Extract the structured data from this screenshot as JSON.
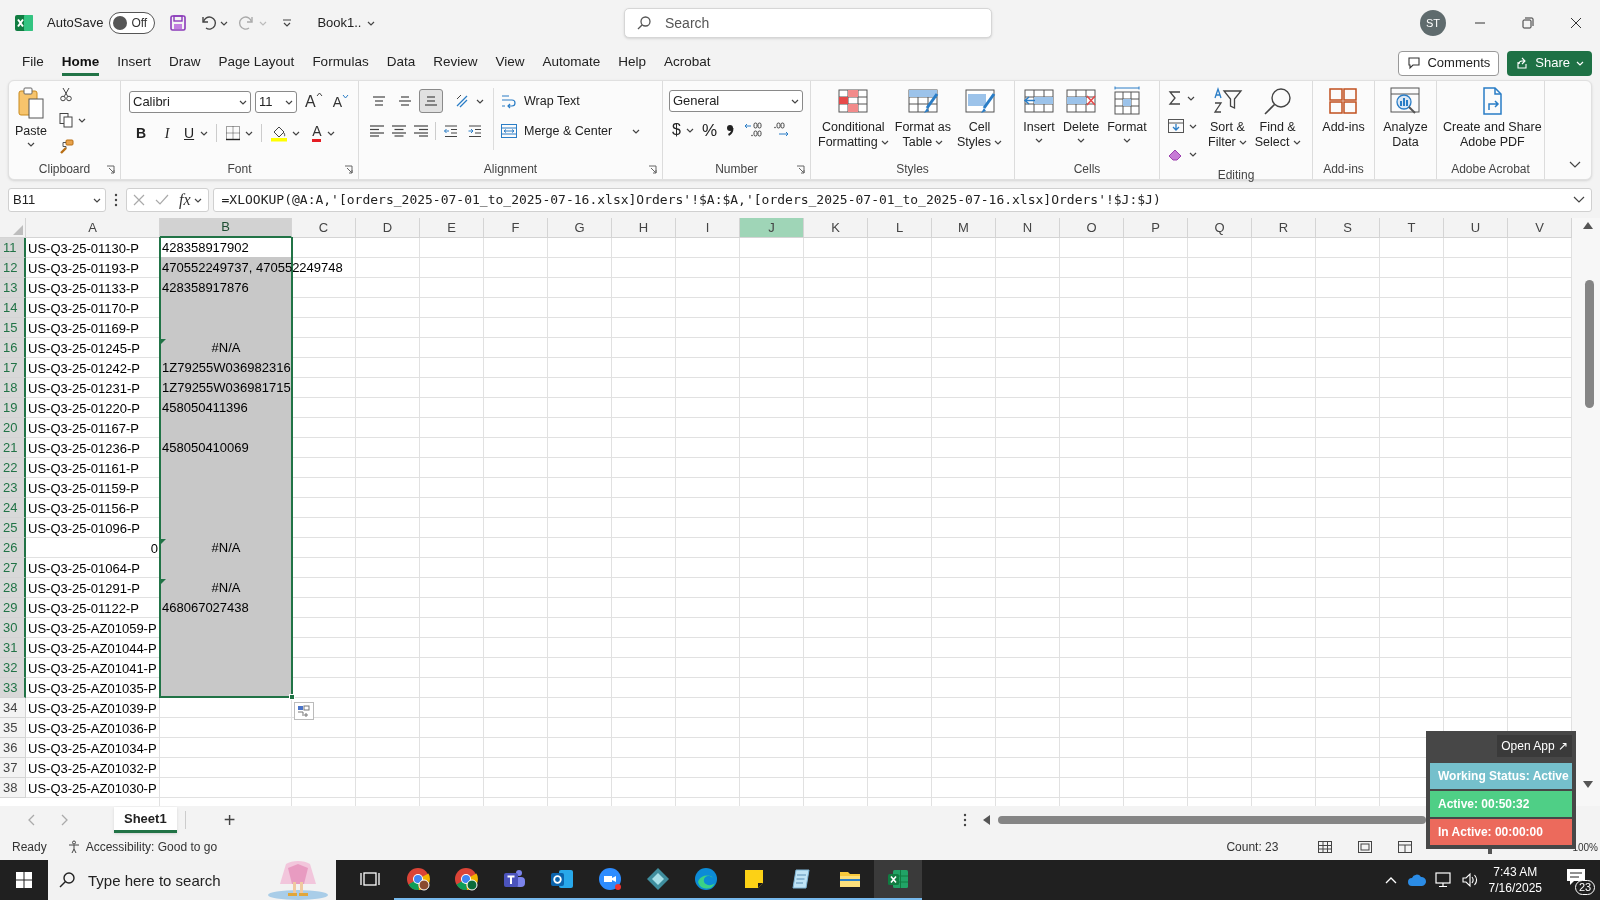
{
  "title_bar": {
    "autosave_label": "AutoSave",
    "autosave_on": false,
    "autosave_state": "Off",
    "document_title": "Book1..",
    "search_placeholder": "Search",
    "avatar": "ST"
  },
  "menu_tabs": [
    {
      "label": "File",
      "selected": false
    },
    {
      "label": "Home",
      "selected": true
    },
    {
      "label": "Insert",
      "selected": false
    },
    {
      "label": "Draw",
      "selected": false
    },
    {
      "label": "Page Layout",
      "selected": false
    },
    {
      "label": "Formulas",
      "selected": false
    },
    {
      "label": "Data",
      "selected": false
    },
    {
      "label": "Review",
      "selected": false
    },
    {
      "label": "View",
      "selected": false
    },
    {
      "label": "Automate",
      "selected": false
    },
    {
      "label": "Help",
      "selected": false
    },
    {
      "label": "Acrobat",
      "selected": false
    }
  ],
  "comments_button": "Comments",
  "share_button": "Share",
  "ribbon_groups": [
    {
      "kind": "clipboard",
      "label": "Clipboard",
      "paste": "Paste"
    },
    {
      "kind": "font",
      "label": "Font",
      "font_name": "Calibri",
      "font_size": "11",
      "grow": "A",
      "shrink": "A",
      "bold": "B",
      "italic": "I",
      "underline": "U",
      "font_color": "A"
    },
    {
      "kind": "alignment",
      "label": "Alignment",
      "vertical_align": [
        {
          "selected": false
        },
        {
          "selected": false
        },
        {
          "selected": true
        }
      ],
      "wrap_text": "Wrap Text",
      "merge": "Merge & Center"
    },
    {
      "kind": "number",
      "label": "Number",
      "format": "General",
      "currency": "$",
      "percent": "%"
    },
    {
      "kind": "styles",
      "label": "Styles",
      "buttons": [
        {
          "lines": [
            "Conditional",
            "Formatting"
          ]
        },
        {
          "lines": [
            "Format as",
            "Table"
          ]
        },
        {
          "lines": [
            "Cell",
            "Styles"
          ]
        }
      ]
    },
    {
      "kind": "cells",
      "label": "Cells",
      "buttons": [
        {
          "lines": [
            "Insert"
          ]
        },
        {
          "lines": [
            "Delete"
          ]
        },
        {
          "lines": [
            "Format"
          ]
        }
      ]
    },
    {
      "kind": "editing",
      "label": "Editing",
      "buttons": [
        {
          "lines": [
            "Sort &",
            "Filter"
          ]
        },
        {
          "lines": [
            "Find &",
            "Select"
          ]
        }
      ]
    },
    {
      "kind": "addins",
      "label": "Add-ins",
      "buttons": [
        {
          "lines": [
            "Add-ins"
          ]
        }
      ]
    },
    {
      "kind": "analyze",
      "buttons": [
        {
          "lines": [
            "Analyze",
            "Data"
          ]
        }
      ]
    },
    {
      "kind": "acrobat",
      "label": "Adobe Acrobat",
      "buttons": [
        {
          "lines": [
            "Create and Share",
            "Adobe PDF"
          ]
        }
      ]
    }
  ],
  "formula_bar": {
    "name_box": "B11",
    "function_button": "fx",
    "formula": "=XLOOKUP(@A:A,'[orders_2025-07-01_to_2025-07-16.xlsx]Orders'!$A:$A,'[orders_2025-07-01_to_2025-07-16.xlsx]Orders'!$J:$J)"
  },
  "columns": [
    {
      "label": "A",
      "selected": false,
      "highlighted": false
    },
    {
      "label": "B",
      "selected": true,
      "highlighted": false
    },
    {
      "label": "C",
      "selected": false,
      "highlighted": false
    },
    {
      "label": "D",
      "selected": false,
      "highlighted": false
    },
    {
      "label": "E",
      "selected": false,
      "highlighted": false
    },
    {
      "label": "F",
      "selected": false,
      "highlighted": false
    },
    {
      "label": "G",
      "selected": false,
      "highlighted": false
    },
    {
      "label": "H",
      "selected": false,
      "highlighted": false
    },
    {
      "label": "I",
      "selected": false,
      "highlighted": false
    },
    {
      "label": "J",
      "selected": false,
      "highlighted": true
    },
    {
      "label": "K",
      "selected": false,
      "highlighted": false
    },
    {
      "label": "L",
      "selected": false,
      "highlighted": false
    },
    {
      "label": "M",
      "selected": false,
      "highlighted": false
    },
    {
      "label": "N",
      "selected": false,
      "highlighted": false
    },
    {
      "label": "O",
      "selected": false,
      "highlighted": false
    },
    {
      "label": "P",
      "selected": false,
      "highlighted": false
    },
    {
      "label": "Q",
      "selected": false,
      "highlighted": false
    },
    {
      "label": "R",
      "selected": false,
      "highlighted": false
    },
    {
      "label": "S",
      "selected": false,
      "highlighted": false
    },
    {
      "label": "T",
      "selected": false,
      "highlighted": false
    },
    {
      "label": "U",
      "selected": false,
      "highlighted": false
    },
    {
      "label": "V",
      "selected": false,
      "highlighted": false
    }
  ],
  "rows": [
    {
      "number": "11",
      "selected": true,
      "a": "US-Q3-25-01130-P",
      "a_numeric": false,
      "b": "428358917902",
      "b_error": false,
      "b_active": true
    },
    {
      "number": "12",
      "selected": true,
      "a": "US-Q3-25-01193-P",
      "a_numeric": false,
      "b": "470552249737, 470552249748",
      "b_error": false,
      "b_active": false
    },
    {
      "number": "13",
      "selected": true,
      "a": "US-Q3-25-01133-P",
      "a_numeric": false,
      "b": "428358917876",
      "b_error": false,
      "b_active": false
    },
    {
      "number": "14",
      "selected": true,
      "a": "US-Q3-25-01170-P",
      "a_numeric": false,
      "b_active": false
    },
    {
      "number": "15",
      "selected": true,
      "a": "US-Q3-25-01169-P",
      "a_numeric": false,
      "b_active": false
    },
    {
      "number": "16",
      "selected": true,
      "a": "US-Q3-25-01245-P",
      "a_numeric": false,
      "b": "#N/A",
      "b_error": true,
      "b_active": false
    },
    {
      "number": "17",
      "selected": true,
      "a": "US-Q3-25-01242-P",
      "a_numeric": false,
      "b": "1Z79255W036982316",
      "b_error": false,
      "b_active": false
    },
    {
      "number": "18",
      "selected": true,
      "a": "US-Q3-25-01231-P",
      "a_numeric": false,
      "b": "1Z79255W036981715",
      "b_error": false,
      "b_active": false
    },
    {
      "number": "19",
      "selected": true,
      "a": "US-Q3-25-01220-P",
      "a_numeric": false,
      "b": "458050411396",
      "b_error": false,
      "b_active": false
    },
    {
      "number": "20",
      "selected": true,
      "a": "US-Q3-25-01167-P",
      "a_numeric": false,
      "b_active": false
    },
    {
      "number": "21",
      "selected": true,
      "a": "US-Q3-25-01236-P",
      "a_numeric": false,
      "b": "458050410069",
      "b_error": false,
      "b_active": false
    },
    {
      "number": "22",
      "selected": true,
      "a": "US-Q3-25-01161-P",
      "a_numeric": false,
      "b_active": false
    },
    {
      "number": "23",
      "selected": true,
      "a": "US-Q3-25-01159-P",
      "a_numeric": false,
      "b_active": false
    },
    {
      "number": "24",
      "selected": true,
      "a": "US-Q3-25-01156-P",
      "a_numeric": false,
      "b_active": false
    },
    {
      "number": "25",
      "selected": true,
      "a": "US-Q3-25-01096-P",
      "a_numeric": false,
      "b_active": false
    },
    {
      "number": "26",
      "selected": true,
      "a": "0",
      "a_numeric": true,
      "b": "#N/A",
      "b_error": true,
      "b_active": false
    },
    {
      "number": "27",
      "selected": true,
      "a": "US-Q3-25-01064-P",
      "a_numeric": false,
      "b_active": false
    },
    {
      "number": "28",
      "selected": true,
      "a": "US-Q3-25-01291-P",
      "a_numeric": false,
      "b": "#N/A",
      "b_error": true,
      "b_active": false
    },
    {
      "number": "29",
      "selected": true,
      "a": "US-Q3-25-01122-P",
      "a_numeric": false,
      "b": "468067027438",
      "b_error": false,
      "b_active": false
    },
    {
      "number": "30",
      "selected": true,
      "a": "US-Q3-25-AZ01059-P",
      "a_numeric": false,
      "b_active": false
    },
    {
      "number": "31",
      "selected": true,
      "a": "US-Q3-25-AZ01044-P",
      "a_numeric": false,
      "b_active": false
    },
    {
      "number": "32",
      "selected": true,
      "a": "US-Q3-25-AZ01041-P",
      "a_numeric": false,
      "b_active": false
    },
    {
      "number": "33",
      "selected": true,
      "a": "US-Q3-25-AZ01035-P",
      "a_numeric": false,
      "b_active": false
    },
    {
      "number": "34",
      "selected": false,
      "a": "US-Q3-25-AZ01039-P",
      "a_numeric": false,
      "b_active": false
    },
    {
      "number": "35",
      "selected": false,
      "a": "US-Q3-25-AZ01036-P",
      "a_numeric": false,
      "b_active": false
    },
    {
      "number": "36",
      "selected": false,
      "a": "US-Q3-25-AZ01034-P",
      "a_numeric": false,
      "b_active": false
    },
    {
      "number": "37",
      "selected": false,
      "a": "US-Q3-25-AZ01032-P",
      "a_numeric": false,
      "b_active": false
    },
    {
      "number": "38",
      "selected": false,
      "a": "US-Q3-25-AZ01030-P",
      "a_numeric": false,
      "b_active": false
    }
  ],
  "sheet_tabs": [
    {
      "label": "Sheet1",
      "selected": true
    }
  ],
  "add_sheet": "+",
  "status_bar": {
    "mode": "Ready",
    "accessibility": "Accessibility: Good to go",
    "count": "Count: 23",
    "zoom_slider": {
      "level": 0.5
    },
    "zoom": "100%"
  },
  "tracker_widget": {
    "open_app": "Open App ↗",
    "status": "Working Status: Active",
    "active": "Active: 00:50:32",
    "inactive": "In Active: 00:00:00"
  },
  "taskbar": {
    "search_placeholder": "Type here to search",
    "apps": [
      {
        "running": false,
        "active": false
      },
      {
        "running": true,
        "active": false
      },
      {
        "running": true,
        "active": false
      },
      {
        "running": true,
        "active": false
      },
      {
        "running": true,
        "active": false
      },
      {
        "running": true,
        "active": false
      },
      {
        "running": true,
        "active": false
      },
      {
        "running": true,
        "active": false
      },
      {
        "running": true,
        "active": false
      },
      {
        "running": true,
        "active": false
      },
      {
        "running": true,
        "active": false
      },
      {
        "running": true,
        "active": true
      }
    ],
    "time": "7:43 AM",
    "date": "7/16/2025",
    "notifications": "23"
  }
}
